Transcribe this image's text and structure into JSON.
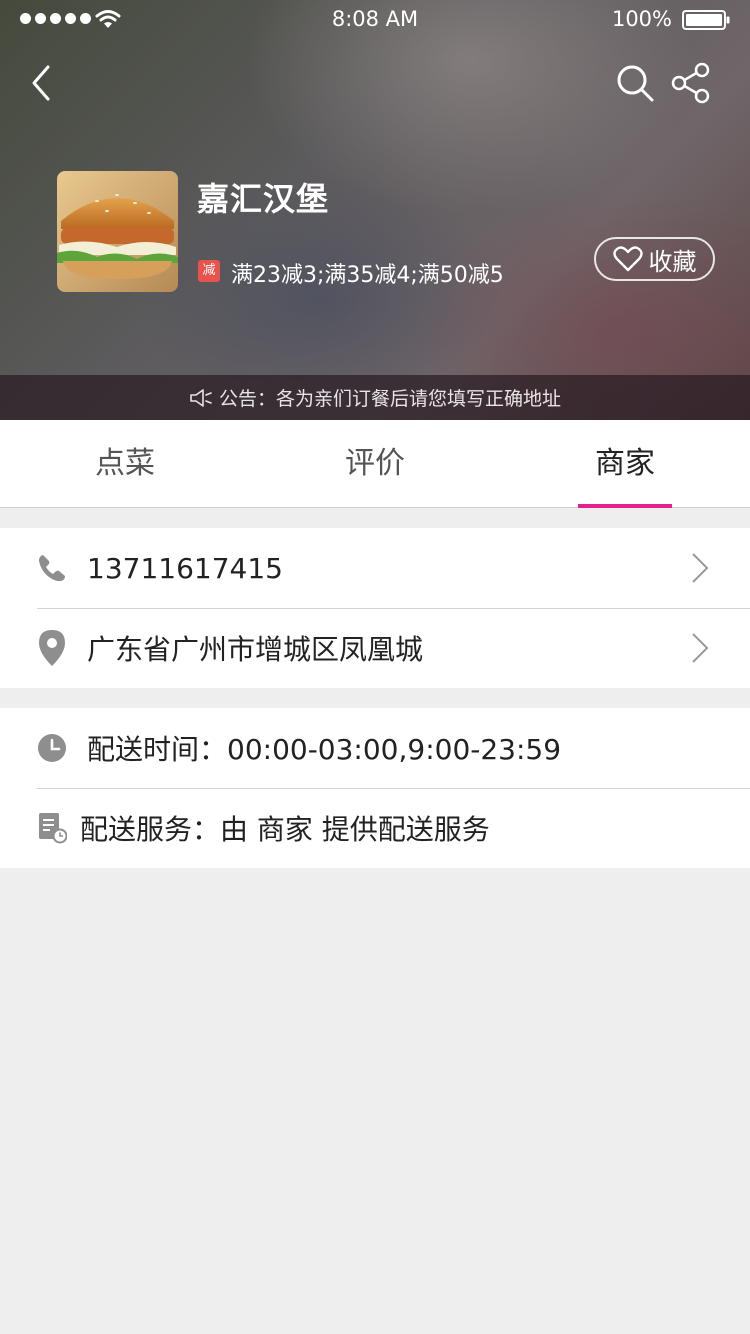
{
  "status_bar": {
    "time": "8:08 AM",
    "battery": "100%"
  },
  "store": {
    "name": "嘉汇汉堡",
    "promo_badge": "减",
    "promotions": "满23减3;满35减4;满50减5",
    "favorite_label": "收藏",
    "notice": "公告：各为亲们订餐后请您填写正确地址"
  },
  "tabs": [
    {
      "label": "点菜",
      "active": false
    },
    {
      "label": "评价",
      "active": false
    },
    {
      "label": "商家",
      "active": true
    }
  ],
  "contact": {
    "phone": "13711617415",
    "address": "广东省广州市增城区凤凰城"
  },
  "delivery": {
    "time": "配送时间：00:00-03:00,9:00-23:59",
    "service": "配送服务：由 商家 提供配送服务"
  },
  "icons": {
    "back": "chevron-left-icon",
    "search": "search-icon",
    "share": "share-icon",
    "favorite": "heart-icon",
    "notice": "speaker-icon",
    "phone": "phone-icon",
    "location": "location-pin-icon",
    "clock": "clock-icon",
    "service": "document-clock-icon"
  },
  "colors": {
    "accent": "#e4218d",
    "promo_badge": "#e8534d"
  }
}
